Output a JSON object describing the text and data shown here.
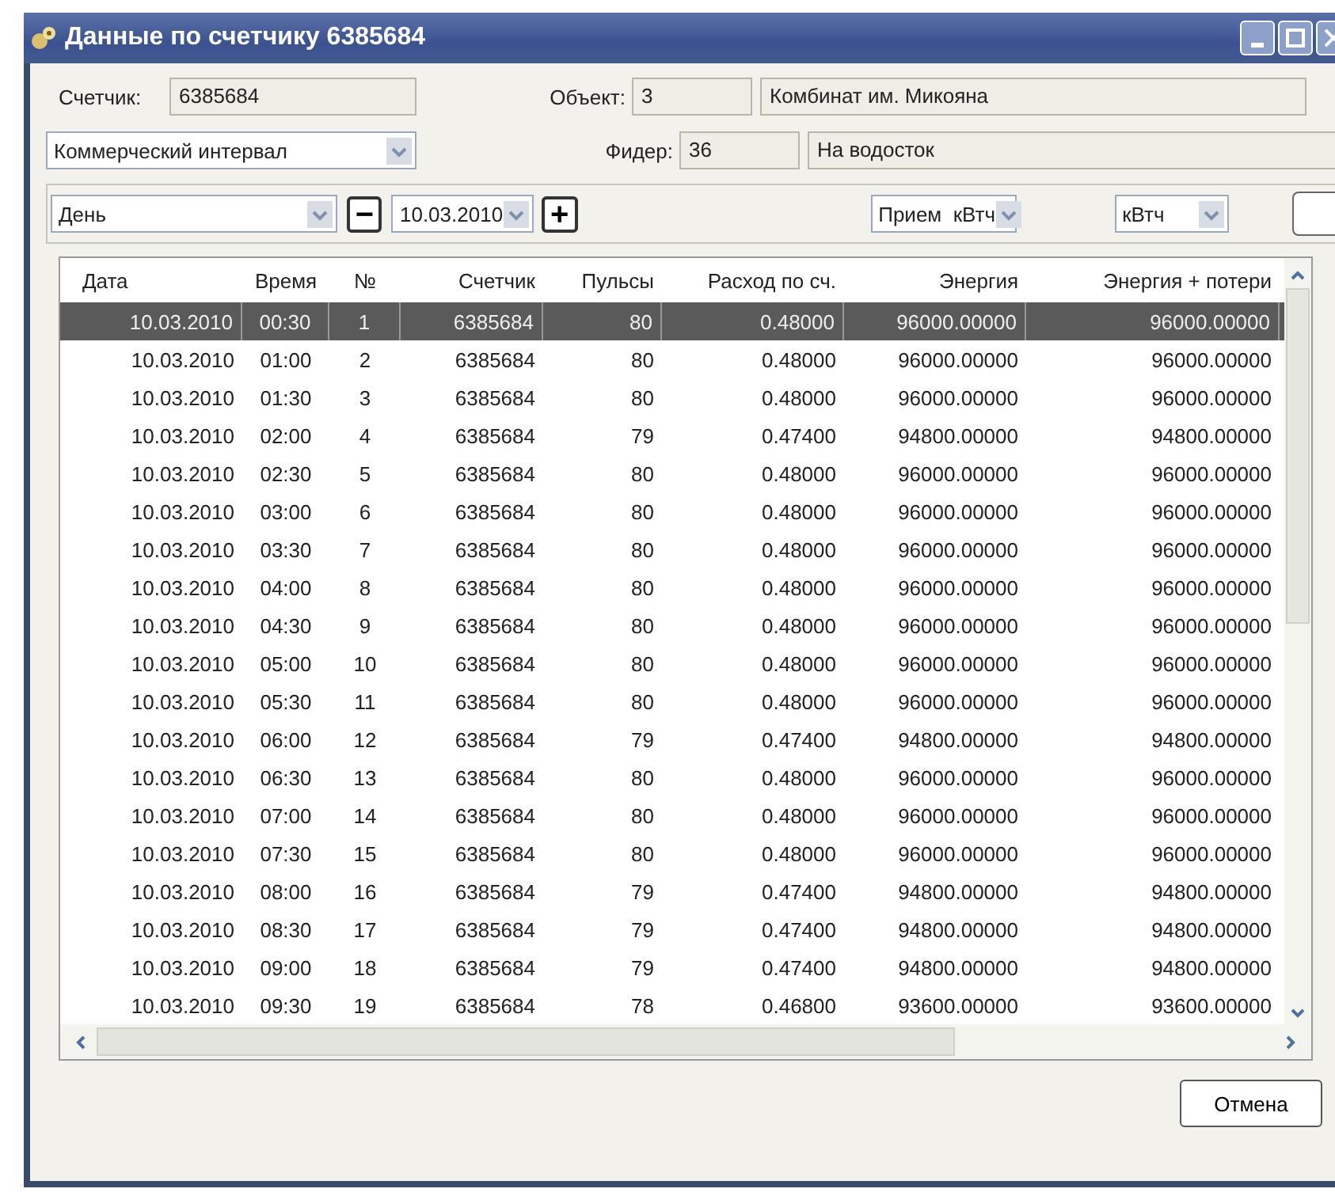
{
  "window": {
    "title": "Данные по счетчику 6385684"
  },
  "meter": {
    "label": "Счетчик:",
    "value": "6385684"
  },
  "object": {
    "label": "Объект:",
    "code": "3",
    "name": "Комбинат им. Микояна"
  },
  "interval": {
    "value": "Коммерческий интервал"
  },
  "feeder": {
    "label": "Фидер:",
    "code": "36",
    "name": "На водосток"
  },
  "toolbar": {
    "period": "День",
    "minus": "−",
    "date": "10.03.2010",
    "plus": "+",
    "direction": "Прием  кВтч",
    "unit": "кВтч"
  },
  "table": {
    "columns": [
      "Дата",
      "Время",
      "№",
      "Счетчик",
      "Пульсы",
      "Расход по сч.",
      "Энергия",
      "Энергия + потери"
    ],
    "rows": [
      {
        "selected": true,
        "cells": [
          "10.03.2010",
          "00:30",
          "1",
          "6385684",
          "80",
          "0.48000",
          "96000.00000",
          "96000.00000"
        ]
      },
      {
        "selected": false,
        "cells": [
          "10.03.2010",
          "01:00",
          "2",
          "6385684",
          "80",
          "0.48000",
          "96000.00000",
          "96000.00000"
        ]
      },
      {
        "selected": false,
        "cells": [
          "10.03.2010",
          "01:30",
          "3",
          "6385684",
          "80",
          "0.48000",
          "96000.00000",
          "96000.00000"
        ]
      },
      {
        "selected": false,
        "cells": [
          "10.03.2010",
          "02:00",
          "4",
          "6385684",
          "79",
          "0.47400",
          "94800.00000",
          "94800.00000"
        ]
      },
      {
        "selected": false,
        "cells": [
          "10.03.2010",
          "02:30",
          "5",
          "6385684",
          "80",
          "0.48000",
          "96000.00000",
          "96000.00000"
        ]
      },
      {
        "selected": false,
        "cells": [
          "10.03.2010",
          "03:00",
          "6",
          "6385684",
          "80",
          "0.48000",
          "96000.00000",
          "96000.00000"
        ]
      },
      {
        "selected": false,
        "cells": [
          "10.03.2010",
          "03:30",
          "7",
          "6385684",
          "80",
          "0.48000",
          "96000.00000",
          "96000.00000"
        ]
      },
      {
        "selected": false,
        "cells": [
          "10.03.2010",
          "04:00",
          "8",
          "6385684",
          "80",
          "0.48000",
          "96000.00000",
          "96000.00000"
        ]
      },
      {
        "selected": false,
        "cells": [
          "10.03.2010",
          "04:30",
          "9",
          "6385684",
          "80",
          "0.48000",
          "96000.00000",
          "96000.00000"
        ]
      },
      {
        "selected": false,
        "cells": [
          "10.03.2010",
          "05:00",
          "10",
          "6385684",
          "80",
          "0.48000",
          "96000.00000",
          "96000.00000"
        ]
      },
      {
        "selected": false,
        "cells": [
          "10.03.2010",
          "05:30",
          "11",
          "6385684",
          "80",
          "0.48000",
          "96000.00000",
          "96000.00000"
        ]
      },
      {
        "selected": false,
        "cells": [
          "10.03.2010",
          "06:00",
          "12",
          "6385684",
          "79",
          "0.47400",
          "94800.00000",
          "94800.00000"
        ]
      },
      {
        "selected": false,
        "cells": [
          "10.03.2010",
          "06:30",
          "13",
          "6385684",
          "80",
          "0.48000",
          "96000.00000",
          "96000.00000"
        ]
      },
      {
        "selected": false,
        "cells": [
          "10.03.2010",
          "07:00",
          "14",
          "6385684",
          "80",
          "0.48000",
          "96000.00000",
          "96000.00000"
        ]
      },
      {
        "selected": false,
        "cells": [
          "10.03.2010",
          "07:30",
          "15",
          "6385684",
          "80",
          "0.48000",
          "96000.00000",
          "96000.00000"
        ]
      },
      {
        "selected": false,
        "cells": [
          "10.03.2010",
          "08:00",
          "16",
          "6385684",
          "79",
          "0.47400",
          "94800.00000",
          "94800.00000"
        ]
      },
      {
        "selected": false,
        "cells": [
          "10.03.2010",
          "08:30",
          "17",
          "6385684",
          "79",
          "0.47400",
          "94800.00000",
          "94800.00000"
        ]
      },
      {
        "selected": false,
        "cells": [
          "10.03.2010",
          "09:00",
          "18",
          "6385684",
          "79",
          "0.47400",
          "94800.00000",
          "94800.00000"
        ]
      },
      {
        "selected": false,
        "cells": [
          "10.03.2010",
          "09:30",
          "19",
          "6385684",
          "78",
          "0.46800",
          "93600.00000",
          "93600.00000"
        ]
      }
    ]
  },
  "buttons": {
    "cancel": "Отмена"
  }
}
